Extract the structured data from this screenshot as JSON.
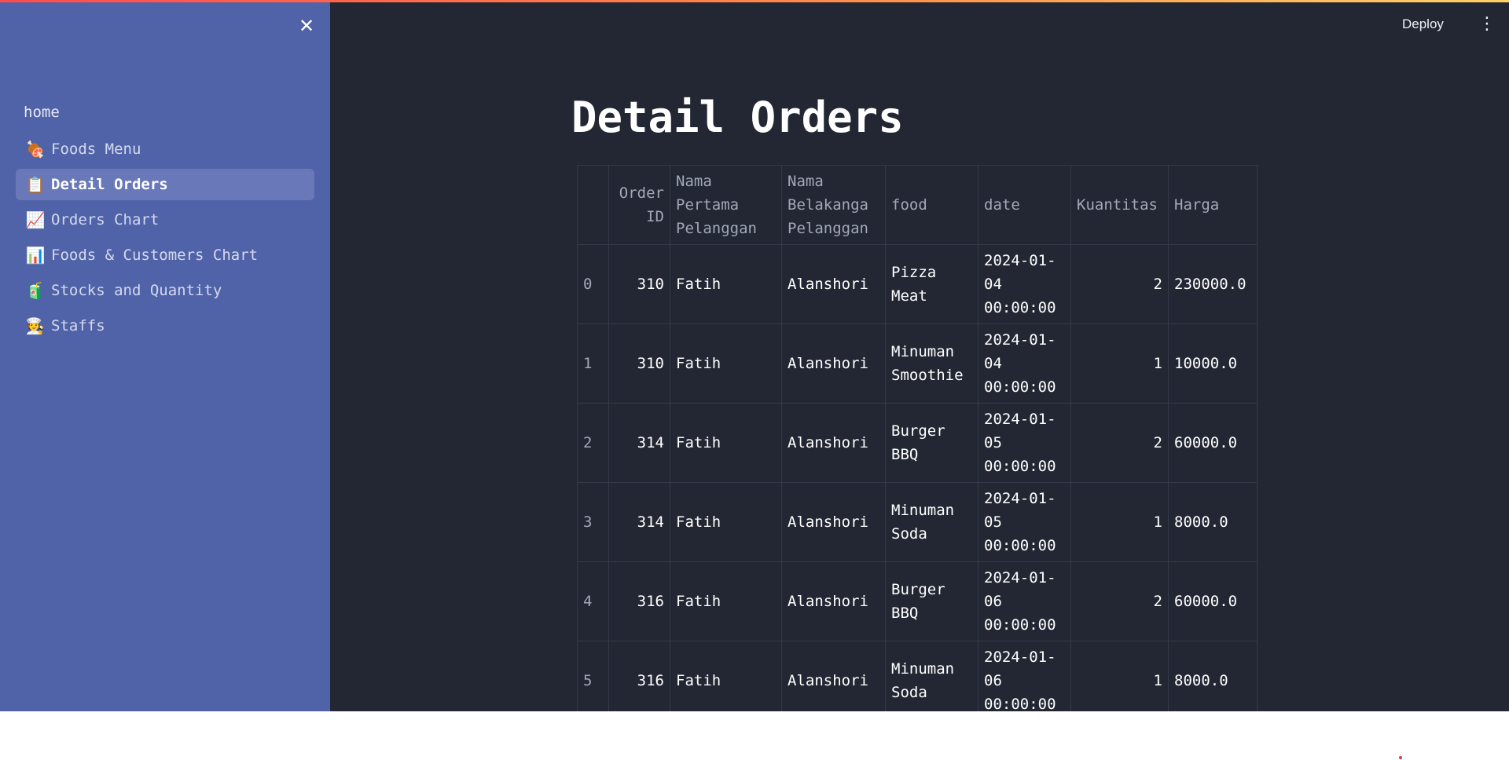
{
  "header": {
    "deploy_label": "Deploy",
    "menu_icon": "⋮"
  },
  "sidebar": {
    "close_icon": "✕",
    "home_label": "home",
    "items": [
      {
        "label": "Foods Menu",
        "icon": "meat-on-bone-icon",
        "glyph": "🍖",
        "active": false
      },
      {
        "label": "Detail Orders",
        "icon": "clipboard-icon",
        "glyph": "📋",
        "active": true
      },
      {
        "label": "Orders Chart",
        "icon": "chart-increasing-icon",
        "glyph": "📈",
        "active": false
      },
      {
        "label": "Foods & Customers Chart",
        "icon": "bar-chart-icon",
        "glyph": "📊",
        "active": false
      },
      {
        "label": "Stocks and Quantity",
        "icon": "beverage-box-icon",
        "glyph": "🧃",
        "active": false
      },
      {
        "label": "Staffs",
        "icon": "cook-icon",
        "glyph": "🧑‍🍳",
        "active": false
      }
    ]
  },
  "main": {
    "title": "Detail Orders",
    "table": {
      "columns": [
        "",
        "Order ID",
        "Nama Pertama Pelanggan",
        "Nama Belakanga Pelanggan",
        "food",
        "date",
        "Kuantitas",
        "Harga"
      ],
      "rows": [
        [
          "0",
          "310",
          "Fatih",
          "Alanshori",
          "Pizza Meat",
          "2024-01-04 00:00:00",
          "2",
          "230000.0"
        ],
        [
          "1",
          "310",
          "Fatih",
          "Alanshori",
          "Minuman Smoothie",
          "2024-01-04 00:00:00",
          "1",
          "10000.0"
        ],
        [
          "2",
          "314",
          "Fatih",
          "Alanshori",
          "Burger BBQ",
          "2024-01-05 00:00:00",
          "2",
          "60000.0"
        ],
        [
          "3",
          "314",
          "Fatih",
          "Alanshori",
          "Minuman Soda",
          "2024-01-05 00:00:00",
          "1",
          "8000.0"
        ],
        [
          "4",
          "316",
          "Fatih",
          "Alanshori",
          "Burger BBQ",
          "2024-01-06 00:00:00",
          "2",
          "60000.0"
        ],
        [
          "5",
          "316",
          "Fatih",
          "Alanshori",
          "Minuman Soda",
          "2024-01-06 00:00:00",
          "1",
          "8000.0"
        ]
      ]
    }
  },
  "colors": {
    "sidebar_bg": "#5163a8",
    "main_bg": "#222733",
    "active_item_bg": "#6878b8"
  }
}
